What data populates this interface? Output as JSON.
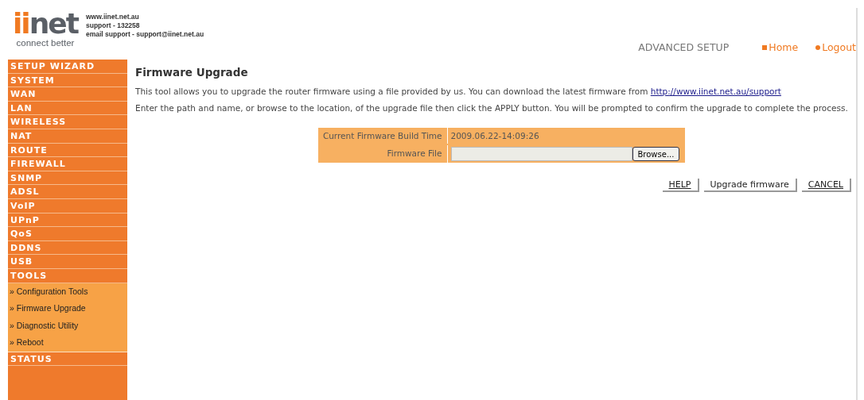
{
  "header": {
    "logo": {
      "accent": "ii",
      "rest": "net",
      "tagline": "connect better"
    },
    "contact_lines": [
      "www.iinet.net.au",
      "support - 132258",
      "email support - support@iinet.net.au"
    ],
    "section_title": "ADVANCED SETUP",
    "links": [
      {
        "label": "Home",
        "kind": "square"
      },
      {
        "label": "Logout",
        "kind": "dot"
      }
    ]
  },
  "sidebar": {
    "items": [
      {
        "label": "SETUP WIZARD"
      },
      {
        "label": "SYSTEM"
      },
      {
        "label": "WAN"
      },
      {
        "label": "LAN"
      },
      {
        "label": "WIRELESS"
      },
      {
        "label": "NAT"
      },
      {
        "label": "ROUTE"
      },
      {
        "label": "FIREWALL"
      },
      {
        "label": "SNMP"
      },
      {
        "label": "ADSL"
      },
      {
        "label": "VoIP"
      },
      {
        "label": "UPnP"
      },
      {
        "label": "QoS"
      },
      {
        "label": "DDNS"
      },
      {
        "label": "USB"
      },
      {
        "label": "TOOLS",
        "expanded": true,
        "children": [
          {
            "label": "» Configuration Tools"
          },
          {
            "label": "» Firmware Upgrade"
          },
          {
            "label": "» Diagnostic Utility"
          },
          {
            "label": "» Reboot"
          }
        ]
      },
      {
        "label": "STATUS"
      }
    ]
  },
  "content": {
    "title": "Firmware Upgrade",
    "intro": "This tool allows you to upgrade the router firmware using a file provided by us. You can download the latest firmware from",
    "intro_link": "http://www.iinet.net.au/support",
    "instructions": "Enter the path and name, or browse to the location, of the upgrade file then click the APPLY button. You will be prompted to confirm the upgrade to complete the process.",
    "form": {
      "build_time_label": "Current Firmware Build Time",
      "build_time": "2009.06.22-14:09:26",
      "file_label": "Firmware File",
      "browse_button": "Browse..."
    },
    "buttons": [
      {
        "label": "HELP",
        "underlined": true
      },
      {
        "label": "Upgrade firmware",
        "underlined": false
      },
      {
        "label": "CANCEL",
        "underlined": true
      }
    ]
  }
}
